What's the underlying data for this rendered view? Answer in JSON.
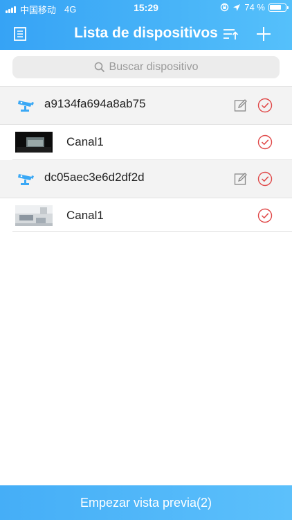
{
  "status_bar": {
    "carrier": "中国移动",
    "network": "4G",
    "time": "15:29",
    "battery_percent": "74 %",
    "battery_level": 0.74
  },
  "nav": {
    "title": "Lista de dispositivos",
    "left_icon": "list-icon",
    "sort_icon": "sort-icon",
    "add_icon": "plus-icon"
  },
  "search": {
    "placeholder": "Buscar dispositivo"
  },
  "devices": [
    {
      "id": "a9134fa694a8ab75",
      "channels": [
        {
          "name": "Canal1"
        }
      ]
    },
    {
      "id": "dc05aec3e6d2df2d",
      "channels": [
        {
          "name": "Canal1"
        }
      ]
    }
  ],
  "bottom_button": {
    "label": "Empezar vista previa(2)"
  },
  "colors": {
    "accent": "#3aa8f5",
    "check": "#e04848"
  }
}
